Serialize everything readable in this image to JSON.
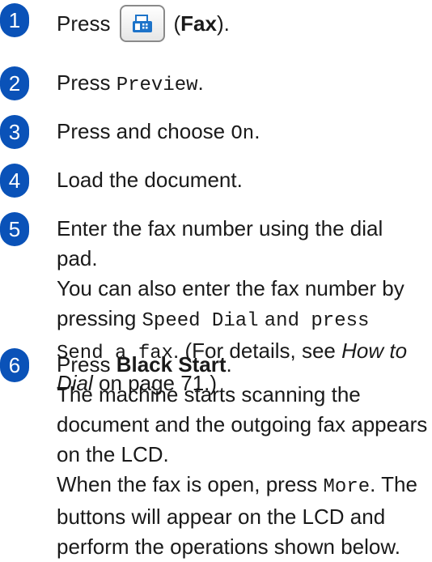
{
  "steps": [
    {
      "number": "1",
      "press": "Press",
      "fax_label": "Fax",
      "fax_close": ")."
    },
    {
      "number": "2",
      "prefix": "Press",
      "code": "Preview",
      "suffix": "."
    },
    {
      "number": "3",
      "prefix": "Press and choose",
      "code": "On",
      "suffix": "."
    },
    {
      "number": "4",
      "text": "Load the document."
    },
    {
      "number": "5",
      "line1": "Enter the fax number using the dial pad.",
      "line2": "You can also enter the fax number by",
      "line3_prefix": "pressing",
      "code1": "Speed Dial",
      "code_and": "and press",
      "code2": "Send a fax",
      "details_prefix": ". (For details, see",
      "details_link": "How to Dial",
      "details_suffix": "on page 71.)"
    },
    {
      "number": "6",
      "press": "Press",
      "bold": "Black Start",
      "para1": "The machine starts scanning the document and the outgoing fax appears on the LCD.",
      "para2_prefix": "When the fax is open, press",
      "code": "More",
      "para2_suffix": ". The buttons will appear on the LCD and perform the operations shown below."
    }
  ],
  "icons": {
    "fax": "fax-machine-icon"
  },
  "colors": {
    "badge": "#0a52b8",
    "icon": "#1d73c9"
  }
}
